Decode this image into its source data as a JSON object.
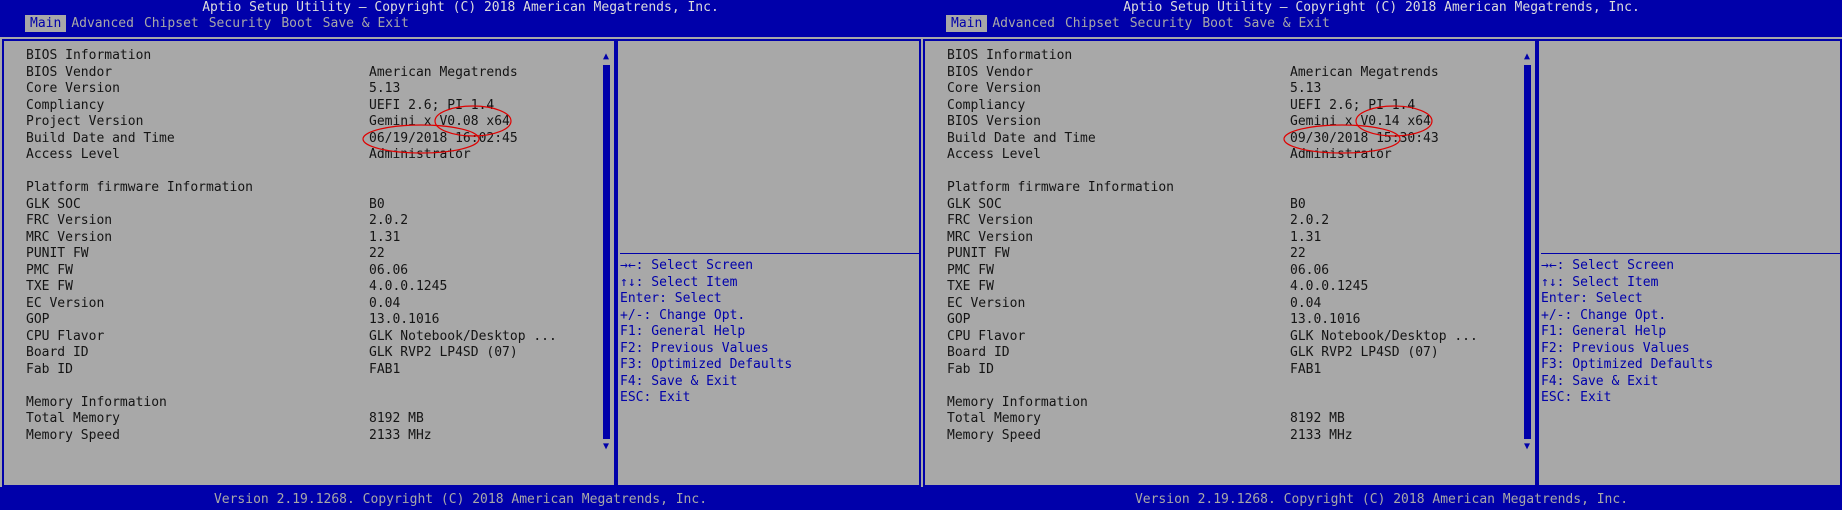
{
  "panels": [
    {
      "title": "Aptio Setup Utility – Copyright (C) 2018 American Megatrends, Inc.",
      "tabs": [
        {
          "label": "Main"
        },
        {
          "label": "Advanced"
        },
        {
          "label": "Chipset"
        },
        {
          "label": "Security"
        },
        {
          "label": "Boot"
        },
        {
          "label": "Save & Exit"
        }
      ],
      "rows": [
        {
          "label": "BIOS Information",
          "value": ""
        },
        {
          "label": "BIOS Vendor",
          "value": "American Megatrends"
        },
        {
          "label": "Core Version",
          "value": "5.13"
        },
        {
          "label": "Compliancy",
          "value": "UEFI 2.6; PI 1.4"
        },
        {
          "label": "Project Version",
          "value": "Gemini x V0.08 x64"
        },
        {
          "label": "Build Date and Time",
          "value": "06/19/2018 16:02:45"
        },
        {
          "label": "Access Level",
          "value": "Administrator"
        },
        {
          "label": "",
          "value": ""
        },
        {
          "label": "Platform firmware Information",
          "value": ""
        },
        {
          "label": "GLK SOC",
          "value": "B0"
        },
        {
          "label": "FRC Version",
          "value": "2.0.2"
        },
        {
          "label": "MRC Version",
          "value": "1.31"
        },
        {
          "label": "PUNIT FW",
          "value": "22"
        },
        {
          "label": "PMC FW",
          "value": "06.06"
        },
        {
          "label": "TXE FW",
          "value": "4.0.0.1245"
        },
        {
          "label": "EC Version",
          "value": "0.04"
        },
        {
          "label": "GOP",
          "value": "13.0.1016"
        },
        {
          "label": "CPU Flavor",
          "value": "GLK Notebook/Desktop ..."
        },
        {
          "label": "Board ID",
          "value": "GLK RVP2 LP4SD (07)"
        },
        {
          "label": "Fab ID",
          "value": "FAB1"
        },
        {
          "label": "",
          "value": ""
        },
        {
          "label": "Memory Information",
          "value": ""
        },
        {
          "label": "Total Memory",
          "value": "8192 MB"
        },
        {
          "label": "Memory Speed",
          "value": "2133 MHz"
        }
      ],
      "help": [
        "→←: Select Screen",
        "↑↓: Select Item",
        "Enter: Select",
        "+/-: Change Opt.",
        "F1: General Help",
        "F2: Previous Values",
        "F3: Optimized Defaults",
        "F4: Save & Exit",
        "ESC: Exit"
      ],
      "footer": "Version 2.19.1268. Copyright (C) 2018 American Megatrends, Inc."
    },
    {
      "title": "Aptio Setup Utility – Copyright (C) 2018 American Megatrends, Inc.",
      "tabs": [
        {
          "label": "Main"
        },
        {
          "label": "Advanced"
        },
        {
          "label": "Chipset"
        },
        {
          "label": "Security"
        },
        {
          "label": "Boot"
        },
        {
          "label": "Save & Exit"
        }
      ],
      "rows": [
        {
          "label": "BIOS Information",
          "value": ""
        },
        {
          "label": "BIOS Vendor",
          "value": "American Megatrends"
        },
        {
          "label": "Core Version",
          "value": "5.13"
        },
        {
          "label": "Compliancy",
          "value": "UEFI 2.6; PI 1.4"
        },
        {
          "label": "BIOS Version",
          "value": "Gemini x V0.14 x64"
        },
        {
          "label": "Build Date and Time",
          "value": "09/30/2018 15:30:43"
        },
        {
          "label": "Access Level",
          "value": "Administrator"
        },
        {
          "label": "",
          "value": ""
        },
        {
          "label": "Platform firmware Information",
          "value": ""
        },
        {
          "label": "GLK SOC",
          "value": "B0"
        },
        {
          "label": "FRC Version",
          "value": "2.0.2"
        },
        {
          "label": "MRC Version",
          "value": "1.31"
        },
        {
          "label": "PUNIT FW",
          "value": "22"
        },
        {
          "label": "PMC FW",
          "value": "06.06"
        },
        {
          "label": "TXE FW",
          "value": "4.0.0.1245"
        },
        {
          "label": "EC Version",
          "value": "0.04"
        },
        {
          "label": "GOP",
          "value": "13.0.1016"
        },
        {
          "label": "CPU Flavor",
          "value": "GLK Notebook/Desktop ..."
        },
        {
          "label": "Board ID",
          "value": "GLK RVP2 LP4SD (07)"
        },
        {
          "label": "Fab ID",
          "value": "FAB1"
        },
        {
          "label": "",
          "value": ""
        },
        {
          "label": "Memory Information",
          "value": ""
        },
        {
          "label": "Total Memory",
          "value": "8192 MB"
        },
        {
          "label": "Memory Speed",
          "value": "2133 MHz"
        }
      ],
      "help": [
        "→←: Select Screen",
        "↑↓: Select Item",
        "Enter: Select",
        "+/-: Change Opt.",
        "F1: General Help",
        "F2: Previous Values",
        "F3: Optimized Defaults",
        "F4: Save & Exit",
        "ESC: Exit"
      ],
      "footer": "Version 2.19.1268. Copyright (C) 2018 American Megatrends, Inc."
    }
  ],
  "active_tab": "Main",
  "icons": {
    "scroll_up": "scroll-up-arrow-icon",
    "scroll_down": "scroll-down-arrow-icon",
    "annotation": "red-circle-annotation"
  },
  "colors": {
    "frame_blue": "#0000aa",
    "panel_gray": "#a8a8a8",
    "value_text": "#141414",
    "title_text": "#dcdcdc",
    "annotation_red": "#e00000"
  }
}
